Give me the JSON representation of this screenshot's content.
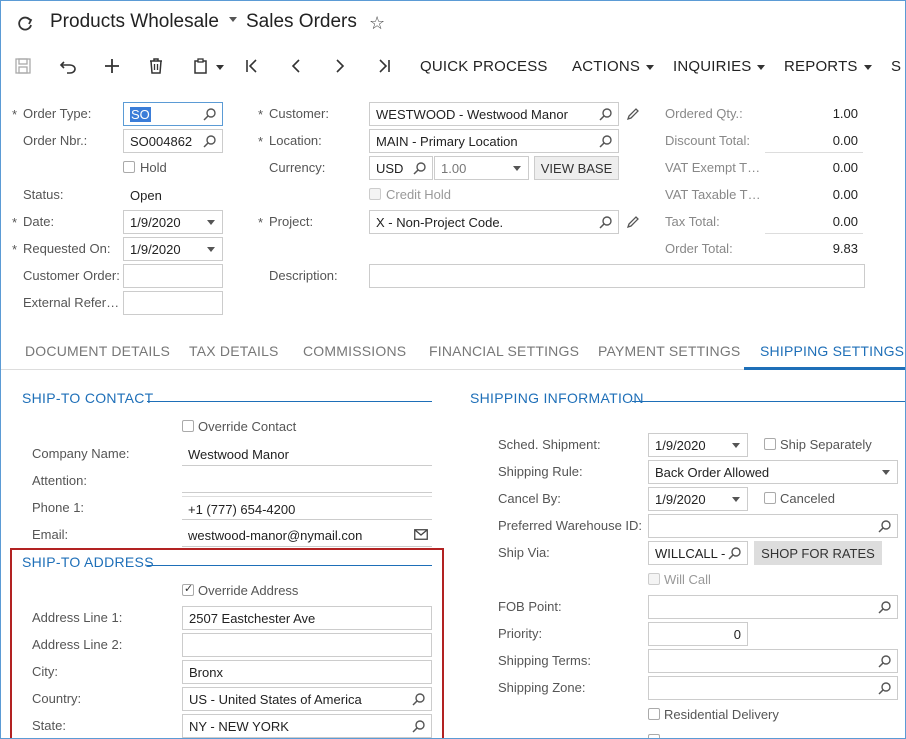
{
  "header": {
    "company": "Products Wholesale",
    "screen": "Sales Orders"
  },
  "toolbar": {
    "quick_process": "QUICK PROCESS",
    "actions": "ACTIONS",
    "inquiries": "INQUIRIES",
    "reports": "REPORTS",
    "more": "S"
  },
  "summary": {
    "order_type_label": "Order Type:",
    "order_type": "SO",
    "order_nbr_label": "Order Nbr.:",
    "order_nbr": "SO004862",
    "hold_label": "Hold",
    "status_label": "Status:",
    "status": "Open",
    "date_label": "Date:",
    "date": "1/9/2020",
    "requested_on_label": "Requested On:",
    "requested_on": "1/9/2020",
    "customer_order_label": "Customer Order:",
    "customer_order": "",
    "external_ref_label": "External Refer…",
    "external_ref": "",
    "customer_label": "Customer:",
    "customer": "WESTWOOD - Westwood Manor",
    "location_label": "Location:",
    "location": "MAIN - Primary Location",
    "currency_label": "Currency:",
    "currency": "USD",
    "rate": "1.00",
    "view_base": "VIEW BASE",
    "credit_hold_label": "Credit Hold",
    "project_label": "Project:",
    "project": "X - Non-Project Code.",
    "description_label": "Description:",
    "description": "",
    "ordered_qty_label": "Ordered Qty.:",
    "ordered_qty": "1.00",
    "discount_total_label": "Discount Total:",
    "discount_total": "0.00",
    "vat_exempt_label": "VAT Exempt T…",
    "vat_exempt": "0.00",
    "vat_taxable_label": "VAT Taxable T…",
    "vat_taxable": "0.00",
    "tax_total_label": "Tax Total:",
    "tax_total": "0.00",
    "order_total_label": "Order Total:",
    "order_total": "9.83"
  },
  "tabs": [
    {
      "label": "DOCUMENT DETAILS"
    },
    {
      "label": "TAX DETAILS"
    },
    {
      "label": "COMMISSIONS"
    },
    {
      "label": "FINANCIAL SETTINGS"
    },
    {
      "label": "PAYMENT SETTINGS"
    },
    {
      "label": "SHIPPING SETTINGS"
    }
  ],
  "ship_to_contact": {
    "title": "SHIP-TO CONTACT",
    "override_label": "Override Contact",
    "company_name_label": "Company Name:",
    "company_name": "Westwood Manor",
    "attention_label": "Attention:",
    "attention": "",
    "phone_label": "Phone 1:",
    "phone": "+1 (777) 654-4200",
    "email_label": "Email:",
    "email": "westwood-manor@nymail.con"
  },
  "ship_to_address": {
    "title": "SHIP-TO ADDRESS",
    "override_label": "Override Address",
    "addr1_label": "Address Line 1:",
    "addr1": "2507 Eastchester Ave",
    "addr2_label": "Address Line 2:",
    "addr2": "",
    "city_label": "City:",
    "city": "Bronx",
    "country_label": "Country:",
    "country": "US - United States of America",
    "state_label": "State:",
    "state": "NY - NEW YORK"
  },
  "shipping_info": {
    "title": "SHIPPING INFORMATION",
    "sched_shipment_label": "Sched. Shipment:",
    "sched_shipment": "1/9/2020",
    "ship_separately_label": "Ship Separately",
    "shipping_rule_label": "Shipping Rule:",
    "shipping_rule": "Back Order Allowed",
    "cancel_by_label": "Cancel By:",
    "cancel_by": "1/9/2020",
    "canceled_label": "Canceled",
    "pref_warehouse_label": "Preferred Warehouse ID:",
    "pref_warehouse": "",
    "ship_via_label": "Ship Via:",
    "ship_via": "WILLCALL -",
    "shop_for_rates": "SHOP FOR RATES",
    "will_call_label": "Will Call",
    "fob_label": "FOB Point:",
    "fob": "",
    "priority_label": "Priority:",
    "priority": "0",
    "shipping_terms_label": "Shipping Terms:",
    "shipping_terms": "",
    "shipping_zone_label": "Shipping Zone:",
    "shipping_zone": "",
    "residential_label": "Residential Delivery"
  }
}
